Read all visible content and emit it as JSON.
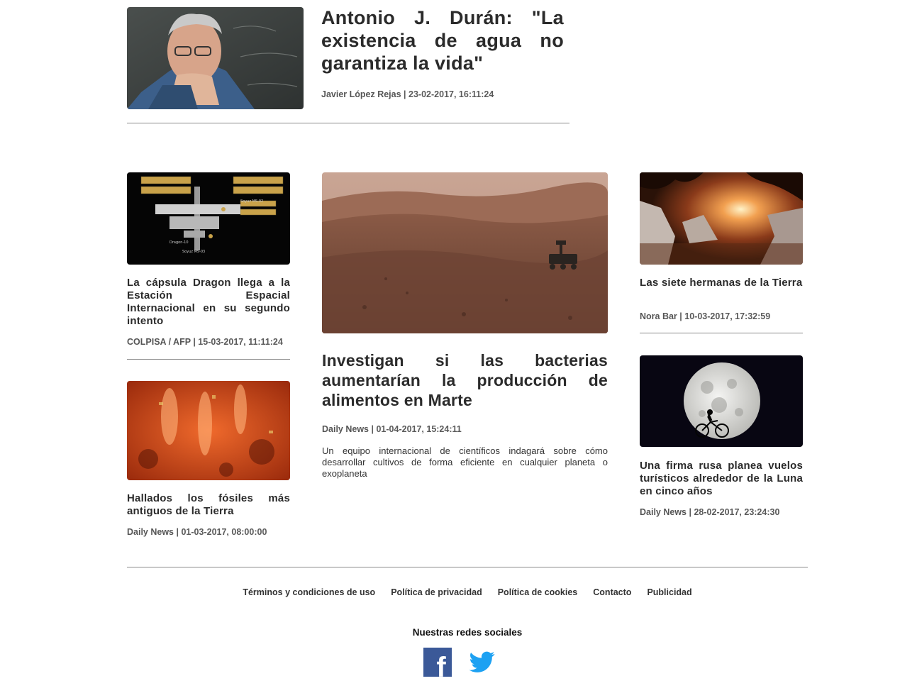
{
  "featured": {
    "title": "Antonio J. Durán: \"La existencia de agua no garantiza la vida\"",
    "author": "Javier López Rejas",
    "date": "23-02-2017, 16:11:24"
  },
  "articles": {
    "dragon": {
      "title": "La cápsula Dragon llega a la Estación Espacial Internacional en su segundo intento",
      "source": "COLPISA / AFP",
      "date": "15-03-2017, 11:11:24"
    },
    "fossils": {
      "title": "Hallados los fósiles más antiguos de la Tierra",
      "source": "Daily News",
      "date": "01-03-2017, 08:00:00"
    },
    "mars": {
      "title": "Investigan si las bacterias aumentarían la producción de alimentos en Marte",
      "source": "Daily News",
      "date": "01-04-2017, 15:24:11",
      "summary": "Un equipo internacional de científicos indagará sobre cómo desarrollar cultivos de forma eficiente en cualquier planeta o exoplaneta"
    },
    "sisters": {
      "title": "Las siete hermanas de la Tierra",
      "source": "Nora Bar",
      "date": "10-03-2017, 17:32:59"
    },
    "moon": {
      "title": "Una firma rusa planea vuelos turísticos alrededor de la Luna en cinco años",
      "source": "Daily News",
      "date": "28-02-2017, 23:24:30"
    }
  },
  "image_labels": {
    "iss_1": "Soyuz MS-03",
    "iss_2": "Dragon-10",
    "iss_3": "Soyuz MS-02"
  },
  "footer": {
    "links": [
      "Términos y condiciones de uso",
      "Política de privacidad",
      "Política de cookies",
      "Contacto",
      "Publicidad"
    ],
    "social_title": "Nuestras redes sociales",
    "facebook_letter": "f"
  },
  "colors": {
    "facebook": "#3b5998",
    "twitter": "#1da1f2",
    "rule": "#8a8a8a"
  },
  "icons": [
    "facebook-icon",
    "twitter-icon"
  ]
}
